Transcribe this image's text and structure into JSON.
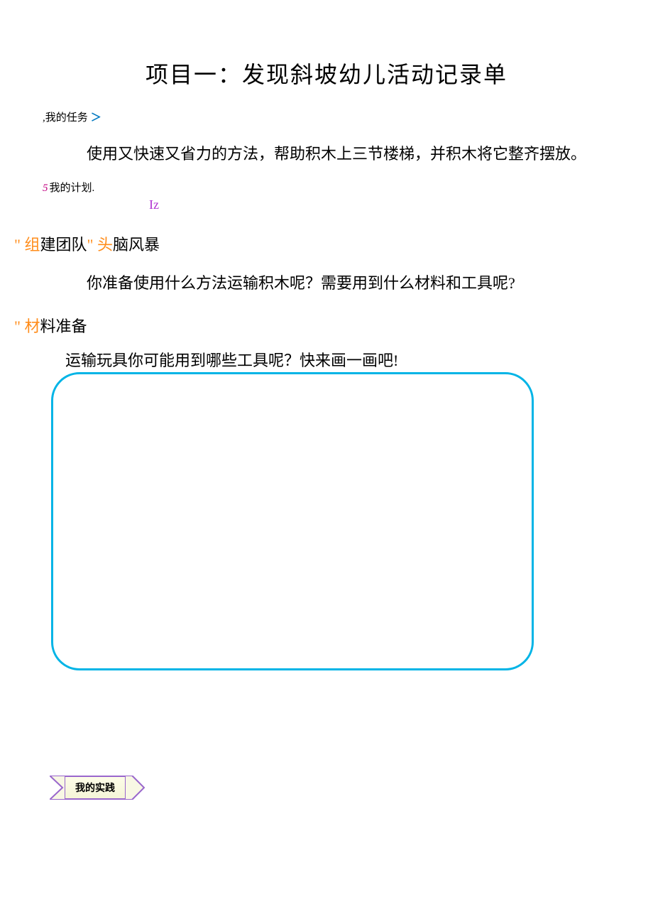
{
  "title": "项目一：发现斜坡幼儿活动记录单",
  "task_label_prefix": ",",
  "task_label_text": "我的任务",
  "task_label_suffix": "＞",
  "task_body": "使用又快速又省力的方法，帮助积木上三节楼梯，并积木将它整齐摆放。",
  "plan_num": "5",
  "plan_label_text": "我的计划.",
  "iz_text": "Iz",
  "team_quote1": "\" ",
  "team_o1": "组",
  "team_mid": "建团队",
  "team_quote2": "\" ",
  "team_o2": "头",
  "team_tail": "脑风暴",
  "team_prompt": "你准备使用什么方法运输积木呢？需要用到什么材料和工具呢?",
  "prep_quote": "\" ",
  "prep_o": "材",
  "prep_tail": "料准备",
  "prep_prompt": "运输玩具你可能用到哪些工具呢？快来画一画吧!",
  "practice_label": "我的实践"
}
